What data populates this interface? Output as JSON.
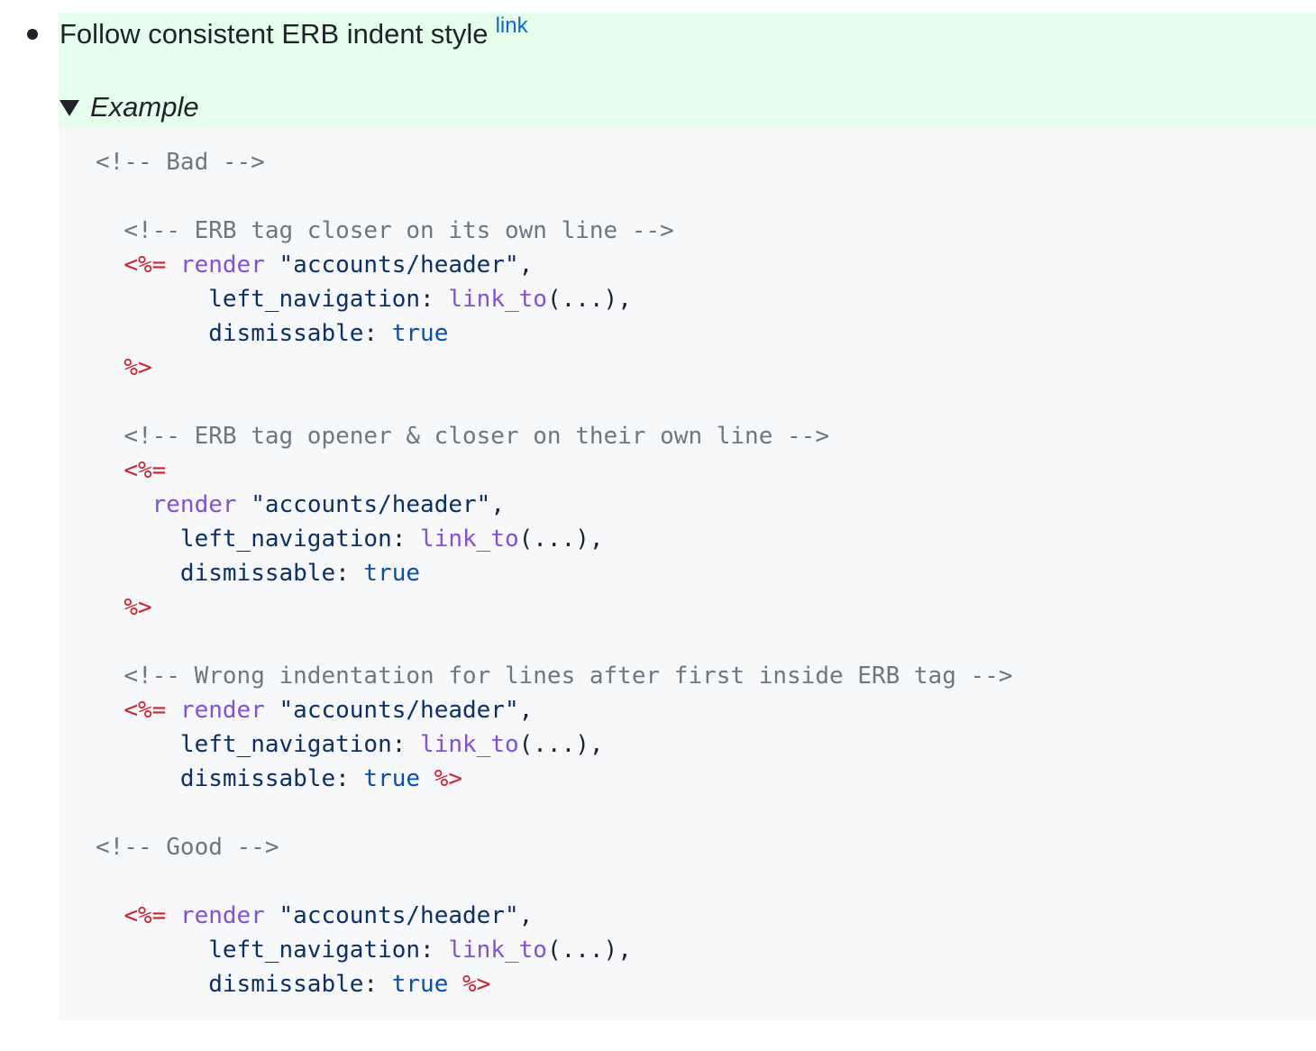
{
  "rule": {
    "text": "Follow consistent ERB indent style",
    "link_label": "link"
  },
  "details": {
    "summary": "Example"
  },
  "code": {
    "c_bad": "<!-- Bad -->",
    "c1": "<!-- ERB tag closer on its own line -->",
    "c2": "<!-- ERB tag opener & closer on their own line -->",
    "c3": "<!-- Wrong indentation for lines after first inside ERB tag -->",
    "c_good": "<!-- Good -->",
    "open": "<%=",
    "close": "%>",
    "render": "render",
    "path": "\"accounts/header\"",
    "comma": ",",
    "left_nav": "left_navigation",
    "colon": ":",
    "link_to": "link_to",
    "args": "(...),",
    "dismissable": "dismissable",
    "true": "true"
  },
  "colors": {
    "highlight_bg": "#e6ffec",
    "code_bg": "#f6f8fa",
    "link": "#0969da",
    "comment": "#6e7781",
    "erb_delimiter": "#cf222e",
    "method": "#8250df",
    "string": "#0a3069",
    "constant": "#0550ae"
  }
}
